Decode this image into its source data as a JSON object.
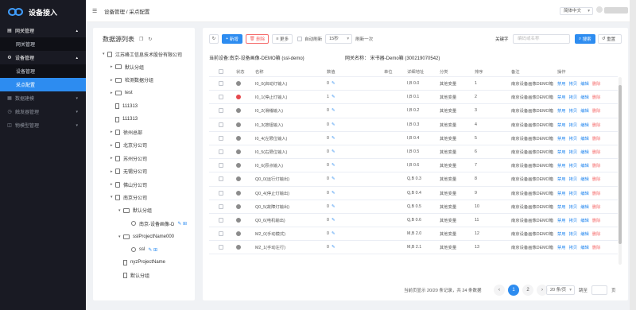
{
  "app": {
    "title": "设备接入"
  },
  "sidebar": {
    "groups": [
      {
        "label": "网关管理",
        "icon": "gateway-icon",
        "expanded": true,
        "items": [
          "网关管理"
        ]
      },
      {
        "label": "设备管理",
        "icon": "gear-icon",
        "expanded": true,
        "items": [
          "设备管理",
          "采点配置"
        ]
      },
      {
        "label": "数据建模",
        "icon": "data-icon",
        "expanded": false,
        "items": []
      },
      {
        "label": "触发器管理",
        "icon": "trigger-icon",
        "expanded": false,
        "items": []
      },
      {
        "label": "物模型管理",
        "icon": "model-icon",
        "expanded": false,
        "items": []
      }
    ],
    "active_item": "采点配置"
  },
  "header": {
    "breadcrumb": [
      "设备管理",
      "采点配置"
    ],
    "separator": " / ",
    "language": "简体中文"
  },
  "tree_panel": {
    "title": "数据源列表",
    "nodes": [
      {
        "label": "江苏峰工信息技术股份有限公司",
        "depth": 0,
        "caret": "▾",
        "icon": "building"
      },
      {
        "label": "默认分组",
        "depth": 1,
        "caret": "▸",
        "icon": "folder"
      },
      {
        "label": "检测数据分组",
        "depth": 1,
        "caret": "▸",
        "icon": "folder"
      },
      {
        "label": "test",
        "depth": 1,
        "caret": "▸",
        "icon": "folder"
      },
      {
        "label": "111313",
        "depth": 1,
        "caret": "",
        "icon": "doc"
      },
      {
        "label": "111313",
        "depth": 1,
        "caret": "",
        "icon": "doc"
      },
      {
        "label": "徐州总部",
        "depth": 1,
        "caret": "▸",
        "icon": "building"
      },
      {
        "label": "北京分公司",
        "depth": 1,
        "caret": "▸",
        "icon": "building"
      },
      {
        "label": "苏州分公司",
        "depth": 1,
        "caret": "▸",
        "icon": "building"
      },
      {
        "label": "无锡分公司",
        "depth": 1,
        "caret": "▸",
        "icon": "building"
      },
      {
        "label": "佛山分公司",
        "depth": 1,
        "caret": "▸",
        "icon": "building"
      },
      {
        "label": "南京分公司",
        "depth": 1,
        "caret": "▾",
        "icon": "building"
      },
      {
        "label": "默认分组",
        "depth": 2,
        "caret": "▾",
        "icon": "folder"
      },
      {
        "label": "南京-设备画像-D",
        "depth": 3,
        "caret": "",
        "icon": "device",
        "actions": "✎ ⊞"
      },
      {
        "label": "sslProjectName000",
        "depth": 2,
        "caret": "▾",
        "icon": "folder"
      },
      {
        "label": "ssl",
        "depth": 3,
        "caret": "",
        "icon": "device",
        "actions": "✎ ⊞"
      },
      {
        "label": "nyzProjectName",
        "depth": 2,
        "caret": "",
        "icon": "doc"
      },
      {
        "label": "默认分组",
        "depth": 2,
        "caret": "",
        "icon": "doc"
      }
    ]
  },
  "toolbar": {
    "add_label": "新增",
    "delete_label": "删除",
    "more_label": "更多",
    "auto_refresh_label": "自动刷新",
    "interval_value": "15秒",
    "refresh_once_label": "刷新一次",
    "keyword_label": "关键字",
    "keyword_placeholder": "编码或名称",
    "search_label": "搜索",
    "reset_label": "重置"
  },
  "info": {
    "current_device": "当前设备:南京-设备画像-DEMO箱 (ssl-demo)",
    "gateway_name": "网关名称：  宋书器-Demo箱 (300219070542)"
  },
  "table": {
    "columns": [
      "",
      "状态",
      "名称",
      "数值",
      "单位",
      "详细地址",
      "分类",
      "排序",
      "备注",
      "操作"
    ],
    "rows": [
      {
        "status": "gray",
        "name": "I0_0(启动灯输入)",
        "value": "0",
        "unit": "",
        "address": "I,B 0.0",
        "category": "其他变量",
        "order": "1",
        "remark": "南京设备画像DEMO箱"
      },
      {
        "status": "red",
        "name": "I0_1(停止灯输入)",
        "value": "1",
        "unit": "",
        "address": "I,B 0.1",
        "category": "其他变量",
        "order": "2",
        "remark": "南京设备画像DEMO箱"
      },
      {
        "status": "gray",
        "name": "I0_2(滑稽输入)",
        "value": "0",
        "unit": "",
        "address": "I,B 0.2",
        "category": "其他变量",
        "order": "3",
        "remark": "南京设备画像DEMO箱"
      },
      {
        "status": "gray",
        "name": "I0_3(按钮输入)",
        "value": "0",
        "unit": "",
        "address": "I,B 0.3",
        "category": "其他变量",
        "order": "4",
        "remark": "南京设备画像DEMO箱"
      },
      {
        "status": "gray",
        "name": "I0_4(左限位输入)",
        "value": "0",
        "unit": "",
        "address": "I,B 0.4",
        "category": "其他变量",
        "order": "5",
        "remark": "南京设备画像DEMO箱"
      },
      {
        "status": "gray",
        "name": "I0_5(右限位输入)",
        "value": "0",
        "unit": "",
        "address": "I,B 0.5",
        "category": "其他变量",
        "order": "6",
        "remark": "南京设备画像DEMO箱"
      },
      {
        "status": "gray",
        "name": "I0_6(原点输入)",
        "value": "0",
        "unit": "",
        "address": "I,B 0.6",
        "category": "其他变量",
        "order": "7",
        "remark": "南京设备画像DEMO箱"
      },
      {
        "status": "gray",
        "name": "Q0_0(运行灯输出)",
        "value": "0",
        "unit": "",
        "address": "Q,B 0.3",
        "category": "其他变量",
        "order": "8",
        "remark": "南京设备画像DEMO箱"
      },
      {
        "status": "gray",
        "name": "Q0_4(停止灯输出)",
        "value": "0",
        "unit": "",
        "address": "Q,B 0.4",
        "category": "其他变量",
        "order": "9",
        "remark": "南京设备画像DEMO箱"
      },
      {
        "status": "gray",
        "name": "Q0_5(故障灯输出)",
        "value": "0",
        "unit": "",
        "address": "Q,B 0.5",
        "category": "其他变量",
        "order": "10",
        "remark": "南京设备画像DEMO箱"
      },
      {
        "status": "gray",
        "name": "Q0_6(电机输出)",
        "value": "0",
        "unit": "",
        "address": "Q,B 0.6",
        "category": "其他变量",
        "order": "11",
        "remark": "南京设备画像DEMO箱"
      },
      {
        "status": "gray",
        "name": "M2_0(手动模式)",
        "value": "0",
        "unit": "",
        "address": "M,B 2.0",
        "category": "其他变量",
        "order": "12",
        "remark": "南京设备画像DEMO箱"
      },
      {
        "status": "gray",
        "name": "M2_1(手动左行)",
        "value": "0",
        "unit": "",
        "address": "M,B 2.1",
        "category": "其他变量",
        "order": "13",
        "remark": "南京设备画像DEMO箱"
      }
    ],
    "row_actions": [
      "禁用",
      "拷贝",
      "编辑",
      "删除"
    ]
  },
  "pagination": {
    "summary": "当前页显示 20/20 条记录，共 24 条数据",
    "pages": [
      "1",
      "2"
    ],
    "current": "1",
    "page_size": "20 条/页",
    "jump_label": "跳至",
    "page_suffix": "页",
    "prev": "‹",
    "next": "›"
  },
  "colors": {
    "primary": "#2d8cf0",
    "danger": "#f56c6c",
    "sidebar": "#191a23",
    "status_on": "#e5484d",
    "status_off": "#8c8c8c"
  }
}
